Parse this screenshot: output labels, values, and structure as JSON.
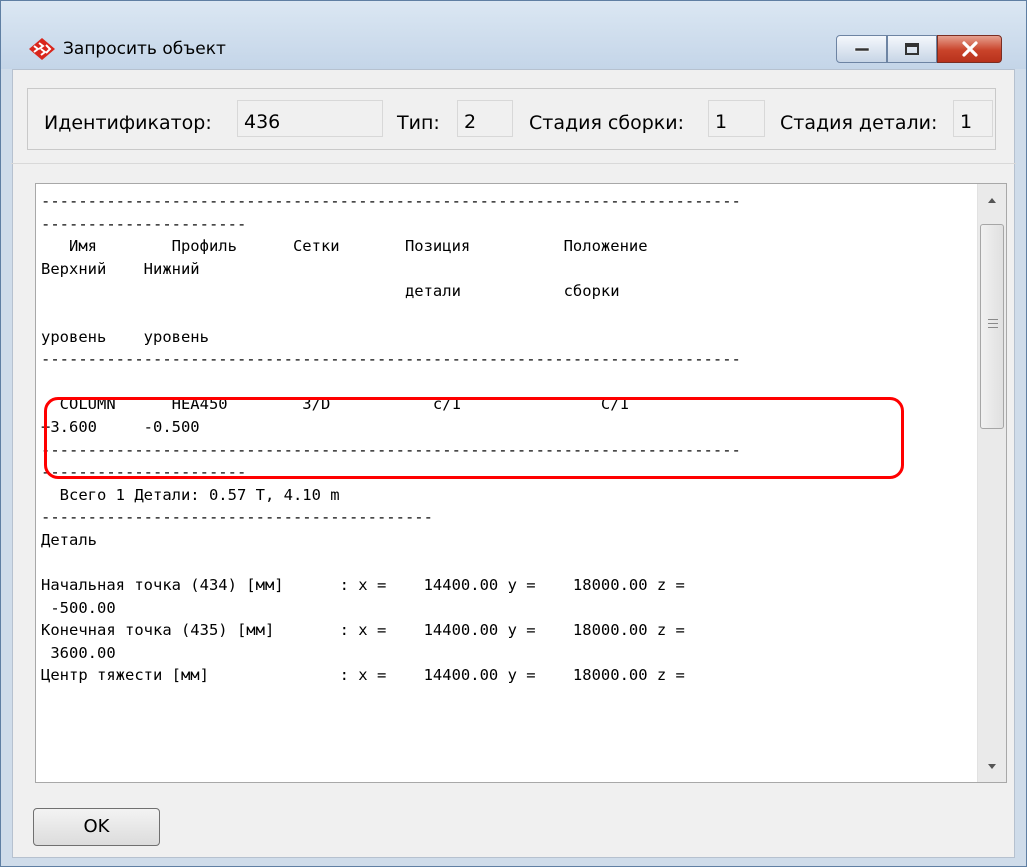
{
  "window": {
    "title": "Запросить объект",
    "controls": {
      "minimize": "minimize",
      "maximize": "maximize",
      "close": "close"
    }
  },
  "fields": {
    "id_label": "Идентификатор:",
    "id_value": "436",
    "type_label": "Тип:",
    "type_value": "2",
    "assembly_stage_label": "Стадия сборки:",
    "assembly_stage_value": "1",
    "part_stage_label": "Стадия детали:",
    "part_stage_value": "1"
  },
  "report": {
    "lines": [
      "---------------------------------------------------------------------------",
      "----------------------",
      "   Имя        Профиль      Сетки       Позиция          Положение",
      "Верхний    Нижний",
      "                                       детали           сборки",
      "",
      "уровень    уровень",
      "---------------------------------------------------------------------------",
      "",
      "  COLUMN      HEA450        3/D           c/1               C/1",
      "+3.600     -0.500",
      "---------------------------------------------------------------------------",
      "----------------------",
      "  Всего 1 Детали: 0.57 T, 4.10 m",
      "------------------------------------------",
      "Деталь",
      "",
      "Начальная точка (434) [мм]      : x =    14400.00 y =    18000.00 z =",
      " -500.00",
      "Конечная точка (435) [мм]       : x =    14400.00 y =    18000.00 z =",
      " 3600.00",
      "Центр тяжести [мм]              : x =    14400.00 y =    18000.00 z ="
    ]
  },
  "buttons": {
    "ok": "OK"
  },
  "colors": {
    "highlight": "#ff0000",
    "close_button": "#c9432a"
  },
  "icons": {
    "app": "tekla-app-icon"
  }
}
